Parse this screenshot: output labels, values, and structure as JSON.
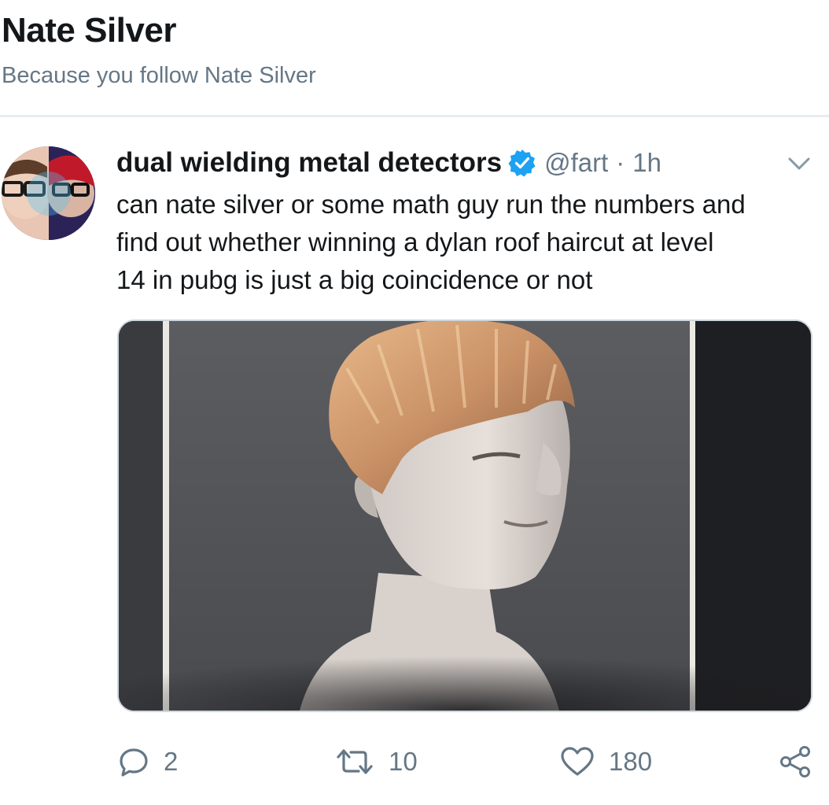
{
  "header": {
    "title": "Nate Silver",
    "subtitle": "Because you follow Nate Silver"
  },
  "tweet": {
    "display_name": "dual wielding metal detectors",
    "verified": true,
    "handle": "@fart",
    "separator": "·",
    "time": "1h",
    "text_lines": [
      "can nate silver or some math guy run the numbers and",
      "find out whether winning a dylan roof haircut at level",
      "14 in pubg is just a big coincidence or not"
    ],
    "actions": {
      "reply_count": "2",
      "retweet_count": "10",
      "like_count": "180"
    }
  },
  "icons": {
    "verified": "verified-badge-icon",
    "caret": "chevron-down-icon",
    "reply": "reply-icon",
    "retweet": "retweet-icon",
    "like": "heart-icon",
    "share": "share-icon"
  },
  "colors": {
    "text_primary": "#14171a",
    "text_secondary": "#657786",
    "verified_blue": "#1da1f2",
    "divider": "#e6ecf0"
  }
}
